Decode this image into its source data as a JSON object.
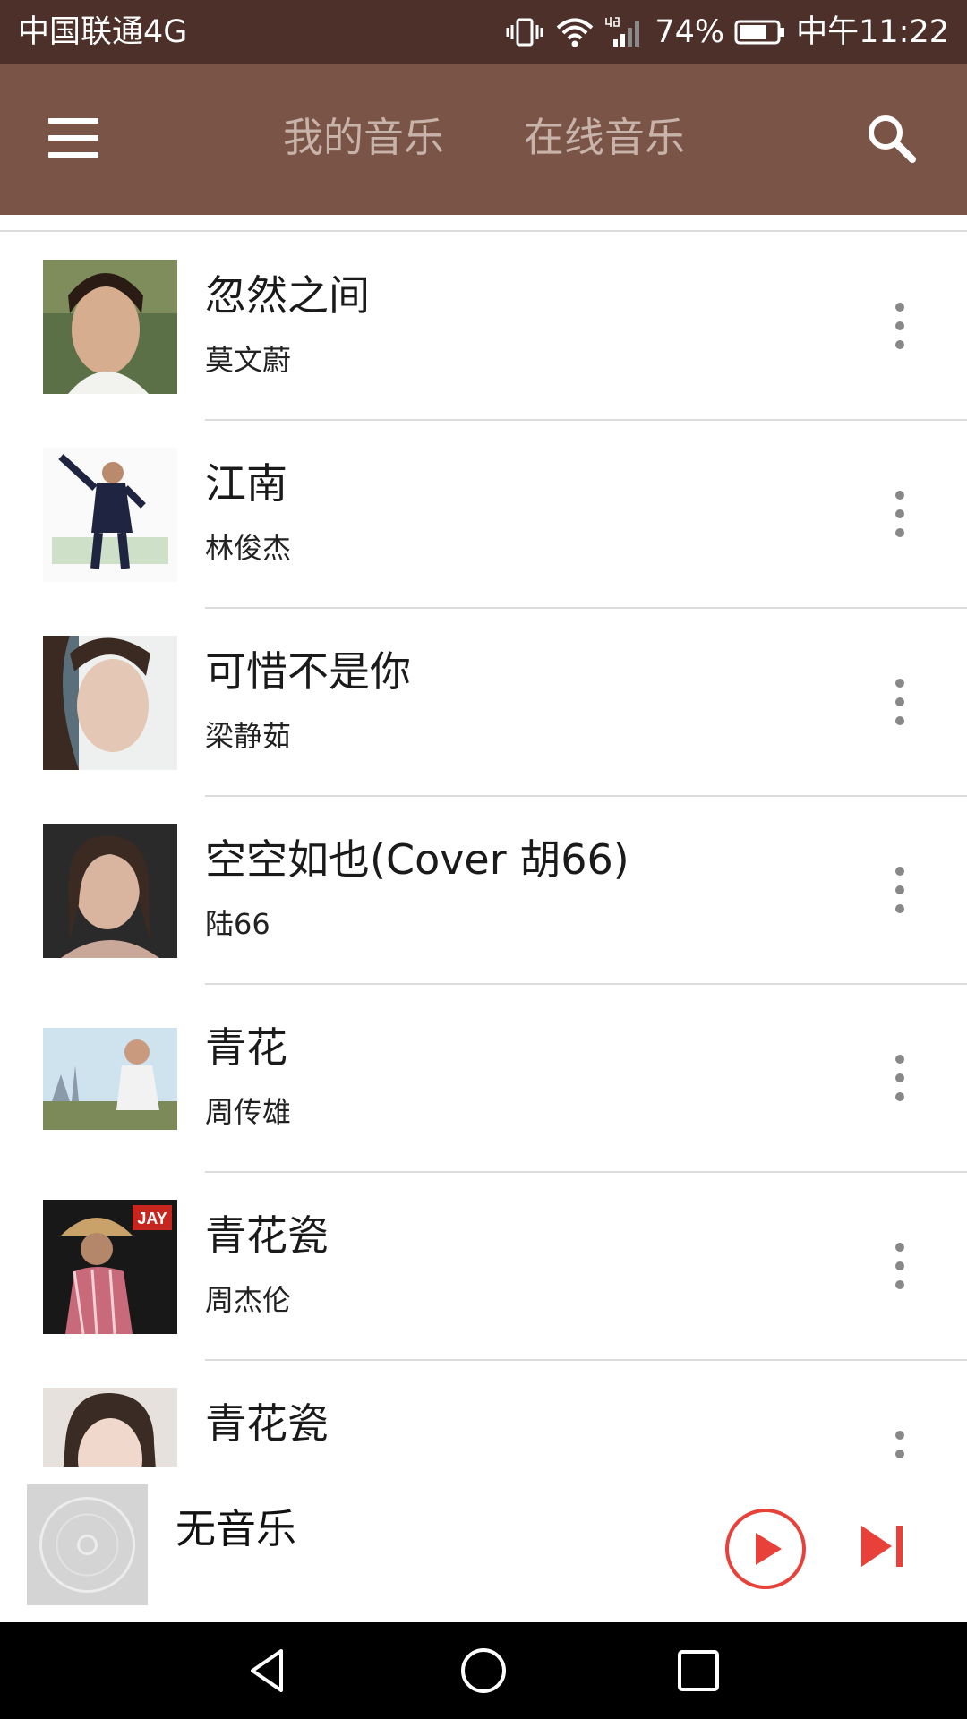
{
  "status_bar": {
    "carrier": "中国联通4G",
    "battery": "74%",
    "time": "中午11:22",
    "icons": [
      "vibrate-icon",
      "wifi-icon",
      "signal-4g-icon",
      "battery-icon"
    ]
  },
  "toolbar": {
    "menu_icon": "hamburger-menu-icon",
    "tabs": [
      {
        "label": "我的音乐"
      },
      {
        "label": "在线音乐"
      }
    ],
    "search_icon": "search-icon",
    "background": "#7a5446"
  },
  "songs": [
    {
      "title": "忽然之间",
      "artist": "莫文蔚"
    },
    {
      "title": "江南",
      "artist": "林俊杰"
    },
    {
      "title": "可惜不是你",
      "artist": "梁静茹"
    },
    {
      "title": "空空如也(Cover 胡66)",
      "artist": "陆66"
    },
    {
      "title": "青花",
      "artist": "周传雄"
    },
    {
      "title": "青花瓷",
      "artist": "周杰伦"
    },
    {
      "title": "青花瓷",
      "artist": ""
    }
  ],
  "cover_logo_text": "JAY",
  "player": {
    "now_playing": "无音乐",
    "accent_color": "#e8413a",
    "icons": [
      "album-placeholder-icon",
      "play-icon",
      "next-icon"
    ]
  },
  "nav_bar": {
    "icons": [
      "back-icon",
      "home-icon",
      "recent-apps-icon"
    ]
  }
}
